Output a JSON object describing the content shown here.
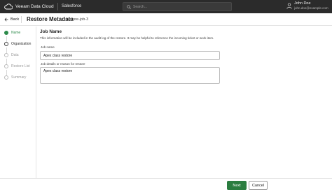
{
  "topbar": {
    "brand": "Veeam Data Cloud",
    "product": "Salesforce",
    "search_placeholder": "Search...",
    "user_name": "John Doe",
    "user_email": "john.doe@example.com"
  },
  "header": {
    "back_label": "Back",
    "title": "Restore Metadata",
    "job_name": "restore-job-3"
  },
  "steps": [
    {
      "label": "Name",
      "state": "active"
    },
    {
      "label": "Organization",
      "state": "current"
    },
    {
      "label": "Data",
      "state": "pending"
    },
    {
      "label": "Restore List",
      "state": "pending"
    },
    {
      "label": "Summary",
      "state": "pending"
    }
  ],
  "form": {
    "section_title": "Job Name",
    "section_desc": "This information will be included in the audit log of the restore. It may be helpful to reference the incoming ticket or work item.",
    "job_name_label": "Job name",
    "job_name_value": "Apex class restore",
    "details_label": "Job details or reason for restore",
    "details_value": "Apex class restore"
  },
  "footer": {
    "next_label": "Next",
    "cancel_label": "Cancel"
  },
  "colors": {
    "topbar_bg": "#2b2b2b",
    "accent_green": "#2b7d40"
  },
  "icons": [
    "cloud-logo-icon",
    "search-icon",
    "user-icon",
    "back-arrow-icon",
    "step-check-icon"
  ]
}
